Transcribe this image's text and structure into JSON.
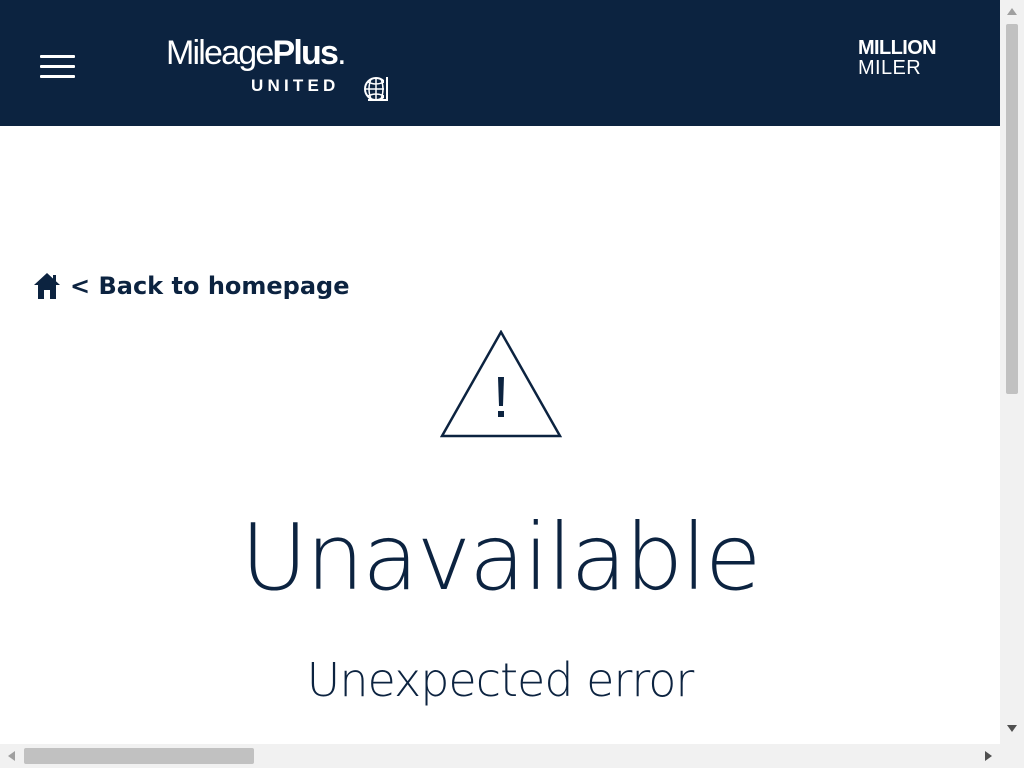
{
  "header": {
    "menu_icon": "hamburger-menu-icon",
    "logo": {
      "text_light": "Mileage",
      "text_bold": "Plus",
      "text_mark": ".",
      "sub": "UNITED",
      "globe_icon": "united-globe-icon"
    },
    "badge": {
      "line1": "MILLION",
      "line2": "MILER"
    }
  },
  "back_link": {
    "icon": "home-icon",
    "label": "< Back to homepage"
  },
  "error": {
    "icon": "warning-triangle-icon",
    "title": "Unavailable",
    "subtitle": "Unexpected error"
  },
  "colors": {
    "brand_navy": "#0c2340",
    "background": "#ffffff"
  }
}
